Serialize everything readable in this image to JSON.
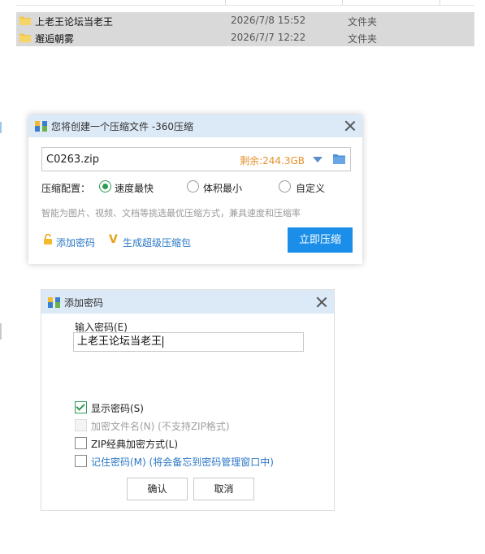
{
  "explorer": {
    "files": [
      {
        "name": "上老王论坛当老王",
        "date": "2026/7/8 15:52",
        "type": "文件夹"
      },
      {
        "name": "邂逅朝雾",
        "date": "2026/7/7 12:22",
        "type": "文件夹"
      }
    ]
  },
  "compress_dialog": {
    "title": "您将创建一个压缩文件 -360压缩",
    "filename": "C0263.zip",
    "remaining_space": "剩余:244.3GB",
    "config_label": "压缩配置：",
    "options": [
      "速度最快",
      "体积最小",
      "自定义"
    ],
    "selected_option": "速度最快",
    "hint": "智能为图片、视频、文档等挑选最优压缩方式，兼具速度和压缩率",
    "add_password_link": "添加密码",
    "super_package_link": "生成超级压缩包",
    "compress_button": "立即压缩"
  },
  "password_dialog": {
    "title": "添加密码",
    "input_label": "输入密码(E)",
    "password_value": "上老王论坛当老王",
    "checkboxes": [
      {
        "label": "显示密码(S)",
        "checked": true,
        "enabled": true
      },
      {
        "label": "加密文件名(N) (不支持ZIP格式)",
        "checked": false,
        "enabled": false
      },
      {
        "label": "ZIP经典加密方式(L)",
        "checked": false,
        "enabled": true
      },
      {
        "label": "记住密码(M) (将会备忘到密码管理窗口中)",
        "checked": false,
        "enabled": true
      }
    ],
    "ok_button": "确认",
    "cancel_button": "取消"
  },
  "colors": {
    "accent_blue": "#1a8ee8",
    "link_blue": "#2b78c5",
    "remaining_orange": "#e7902a",
    "check_green": "#2e9b54",
    "titlebar_bg": "#dce9f7"
  }
}
